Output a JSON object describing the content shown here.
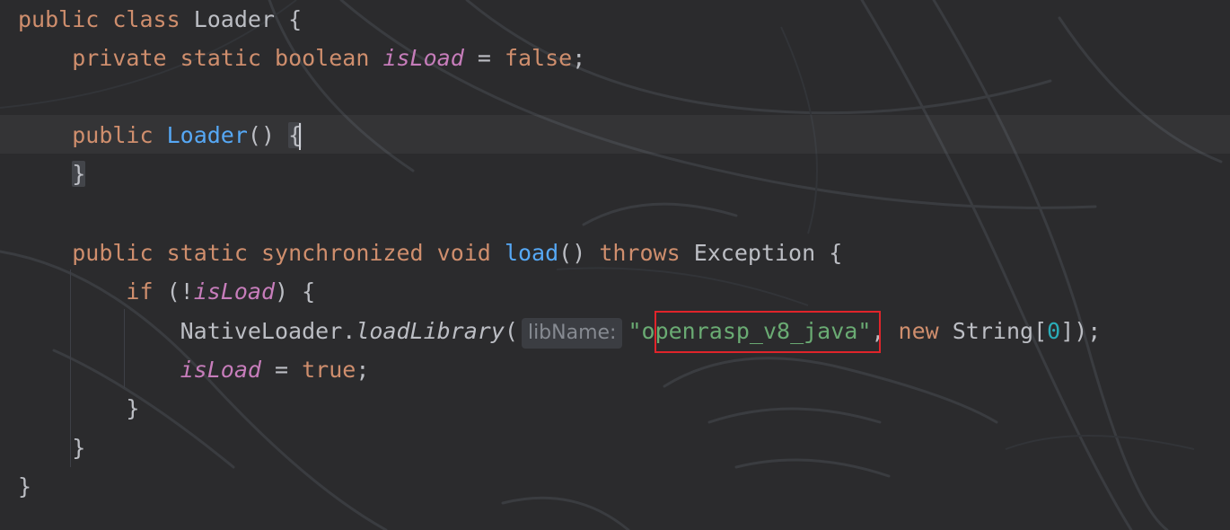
{
  "code": {
    "l1_public": "public",
    "l1_class": "class",
    "l1_name": "Loader",
    "l1_brace": "{",
    "l2_private": "private",
    "l2_static": "static",
    "l2_type": "boolean",
    "l2_field": "isLoad",
    "l2_assign": "=",
    "l2_value": "false",
    "l2_semi": ";",
    "l4_public": "public",
    "l4_ctor": "Loader",
    "l4_parens": "()",
    "l4_brace": "{",
    "l5_brace": "}",
    "l7_public": "public",
    "l7_static": "static",
    "l7_sync": "synchronized",
    "l7_void": "void",
    "l7_method": "load",
    "l7_parens": "()",
    "l7_throws": "throws",
    "l7_exc": "Exception",
    "l7_brace": "{",
    "l8_if": "if",
    "l8_open": "(!",
    "l8_field": "isLoad",
    "l8_close": ")",
    "l8_brace": "{",
    "l9_class": "NativeLoader",
    "l9_dot": ".",
    "l9_method": "loadLibrary",
    "l9_paren": "(",
    "l9_hint": "libName:",
    "l9_string": "\"openrasp_v8_java\"",
    "l9_comma": ",",
    "l9_new": "new",
    "l9_type": "String",
    "l9_bopen": "[",
    "l9_num": "0",
    "l9_end": "]);",
    "l10_field": "isLoad",
    "l10_assign": "=",
    "l10_value": "true",
    "l10_semi": ";",
    "l11_brace": "}",
    "l12_brace": "}",
    "l13_brace": "}"
  },
  "colors": {
    "background": "#2b2b2d",
    "keyword": "#cf8e6d",
    "field": "#c77dbb",
    "method": "#56a8f5",
    "string": "#6aab73",
    "number": "#2aacb8",
    "text": "#bcbec4",
    "highlight_box": "#e0242a"
  }
}
